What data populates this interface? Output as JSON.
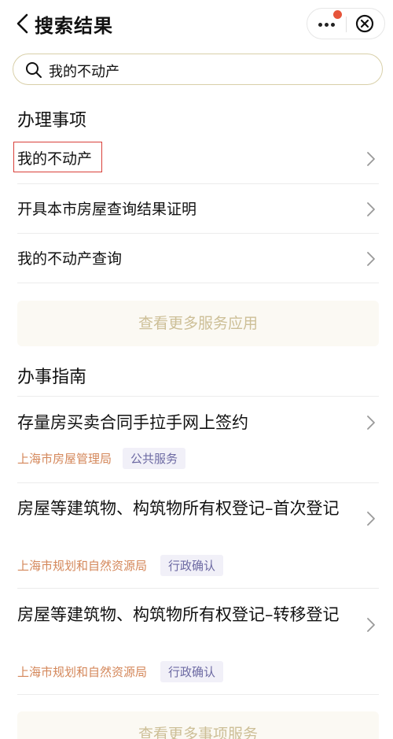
{
  "header": {
    "title": "搜索结果"
  },
  "search": {
    "query": "我的不动产"
  },
  "sections": {
    "services_title": "办理事项",
    "guides_title": "办事指南"
  },
  "services": [
    {
      "label": "我的不动产"
    },
    {
      "label": "开具本市房屋查询结果证明"
    },
    {
      "label": "我的不动产查询"
    }
  ],
  "more_services_label": "查看更多服务应用",
  "guides": [
    {
      "title": "存量房买卖合同手拉手网上签约",
      "org": "上海市房屋管理局",
      "type": "公共服务"
    },
    {
      "title": "房屋等建筑物、构筑物所有权登记–首次登记",
      "org": "上海市规划和自然资源局",
      "type": "行政确认"
    },
    {
      "title": "房屋等建筑物、构筑物所有权登记–转移登记",
      "org": "上海市规划和自然资源局",
      "type": "行政确认"
    }
  ],
  "more_guides_label": "查看更多事项服务",
  "colors": {
    "accent_border": "#d8cfa8",
    "highlight": "#d9403a",
    "org_tag": "#d4875a",
    "type_tag": "#6d6aa3",
    "notification_dot": "#e6543a"
  }
}
